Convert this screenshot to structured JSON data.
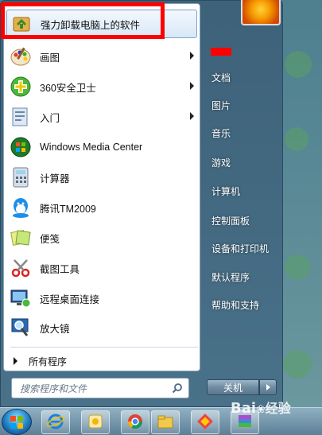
{
  "programs": [
    {
      "label": "强力卸载电脑上的软件",
      "icon": "uninstaller-icon",
      "has_submenu": false,
      "highlighted": true
    },
    {
      "label": "画图",
      "icon": "paint-icon",
      "has_submenu": true
    },
    {
      "label": "360安全卫士",
      "icon": "360-safeguard-icon",
      "has_submenu": true
    },
    {
      "label": "入门",
      "icon": "getting-started-icon",
      "has_submenu": true
    },
    {
      "label": "Windows Media Center",
      "icon": "media-center-icon",
      "has_submenu": false
    },
    {
      "label": "计算器",
      "icon": "calculator-icon",
      "has_submenu": false
    },
    {
      "label": "腾讯TM2009",
      "icon": "tencent-tm-icon",
      "has_submenu": false
    },
    {
      "label": "便笺",
      "icon": "sticky-notes-icon",
      "has_submenu": false
    },
    {
      "label": "截图工具",
      "icon": "snipping-tool-icon",
      "has_submenu": false
    },
    {
      "label": "远程桌面连接",
      "icon": "remote-desktop-icon",
      "has_submenu": false
    },
    {
      "label": "放大镜",
      "icon": "magnifier-icon",
      "has_submenu": false
    }
  ],
  "all_programs_label": "所有程序",
  "search": {
    "placeholder": "搜索程序和文件"
  },
  "right_pane": [
    {
      "label": "文档"
    },
    {
      "label": "图片"
    },
    {
      "label": "音乐"
    },
    {
      "label": "游戏"
    },
    {
      "label": "计算机"
    },
    {
      "label": "控制面板"
    },
    {
      "label": "设备和打印机"
    },
    {
      "label": "默认程序"
    },
    {
      "label": "帮助和支持"
    }
  ],
  "shutdown_label": "关机",
  "taskbar": {
    "items": [
      "internet-explorer-icon",
      "qq-icon",
      "chrome-icon",
      "file-explorer-icon",
      "app-icon",
      "winrar-icon"
    ]
  },
  "watermark": {
    "brand": "Bai",
    "brand2": "经验"
  },
  "colors": {
    "highlight_border": "#ff0000",
    "accent": "#2d8fd0"
  }
}
